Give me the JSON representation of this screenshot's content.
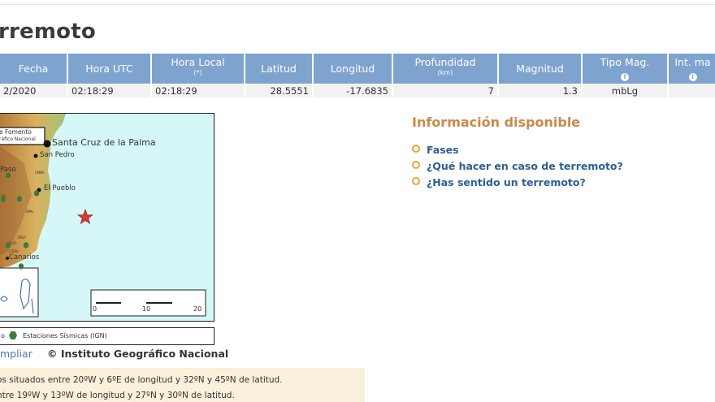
{
  "page": {
    "title": "rremoto"
  },
  "table": {
    "headers": [
      {
        "label": "Fecha",
        "sub": ""
      },
      {
        "label": "Hora UTC",
        "sub": ""
      },
      {
        "label": "Hora Local",
        "sub": "(*)"
      },
      {
        "label": "Latitud",
        "sub": ""
      },
      {
        "label": "Longitud",
        "sub": ""
      },
      {
        "label": "Profundidad",
        "sub": "(km)"
      },
      {
        "label": "Magnitud",
        "sub": ""
      },
      {
        "label": "Tipo Mag.",
        "sub": "i"
      },
      {
        "label": "Int. ma",
        "sub": "i"
      }
    ],
    "row": [
      "2/2020",
      "02:18:29",
      "02:18:29",
      "28.5551",
      "-17.6835",
      "7",
      "1.3",
      "mbLg",
      ""
    ]
  },
  "map": {
    "inset_lines": [
      "e Fomento",
      "ráfico Nacional"
    ],
    "places": [
      "Santa Cruz de la Palma",
      "San Pedro",
      "El Pueblo",
      "Paso",
      "Canarios"
    ],
    "small_labels": [
      "CMBE",
      "TLP1",
      "EPAL",
      "CTEN",
      "EPLP",
      "LP"
    ],
    "scale": {
      "min": "0",
      "mid": "10",
      "max": "20"
    },
    "legend": {
      "left": "o",
      "stations": "Estaciones Sísmicas (IGN)"
    },
    "colors": {
      "sea": "#d6f7f7",
      "epicenter": "#e23636",
      "station": "#3f7a3a"
    }
  },
  "credits": {
    "ampliar": "mpliar",
    "ign": "© Instituto Geográfico Nacional"
  },
  "info": {
    "title": "Información disponible",
    "links": [
      "Fases",
      "¿Qué hacer en caso de terremoto?",
      "¿Has sentido un terremoto?"
    ]
  },
  "note": {
    "lines": [
      "os situados entre 20ºW y 6ºE de longitud y 32ºN y 45ºN de latitud.",
      "ntre 19ºW y 13ºW de longitud y 27ºN y 30ºN de latitud."
    ]
  }
}
